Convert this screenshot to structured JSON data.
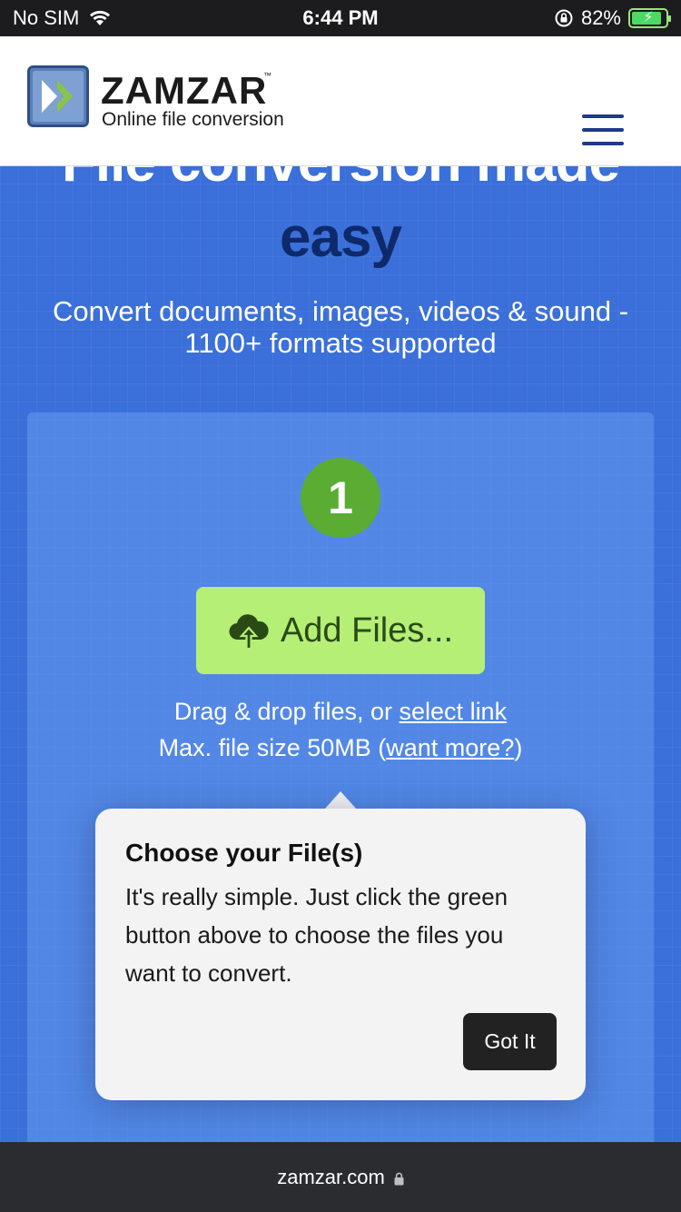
{
  "status_bar": {
    "carrier": "No SIM",
    "time": "6:44 PM",
    "battery_percent": "82%",
    "icons": [
      "wifi-icon",
      "orientation-lock-icon",
      "battery-charging-icon"
    ]
  },
  "header": {
    "logo_text": "ZAMZAR",
    "logo_tm": "™",
    "tagline": "Online file conversion",
    "menu_icon": "hamburger-menu-icon"
  },
  "hero": {
    "title_line1": "File conversion made",
    "title_line2": "easy",
    "subtitle": "Convert documents, images, videos & sound - 1100+ formats supported"
  },
  "converter": {
    "step_number": "1",
    "add_files_label": "Add Files...",
    "add_files_icon": "cloud-upload-icon",
    "drag_text": "Drag & drop files, or ",
    "select_link": "select link",
    "max_size_text": "Max. file size 50MB (",
    "want_more_link": "want more?",
    "max_size_close": ")"
  },
  "tooltip": {
    "title": "Choose your File(s)",
    "body": "It's really simple. Just click the green button above to choose the files you want to convert.",
    "button": "Got It"
  },
  "browser": {
    "url": "zamzar.com"
  },
  "colors": {
    "hero_blue": "#3b6fd9",
    "title_dark": "#0e2a6b",
    "step_green": "#5aac33",
    "button_green": "#b5ef76",
    "logo_navy": "#1f3a8a"
  }
}
